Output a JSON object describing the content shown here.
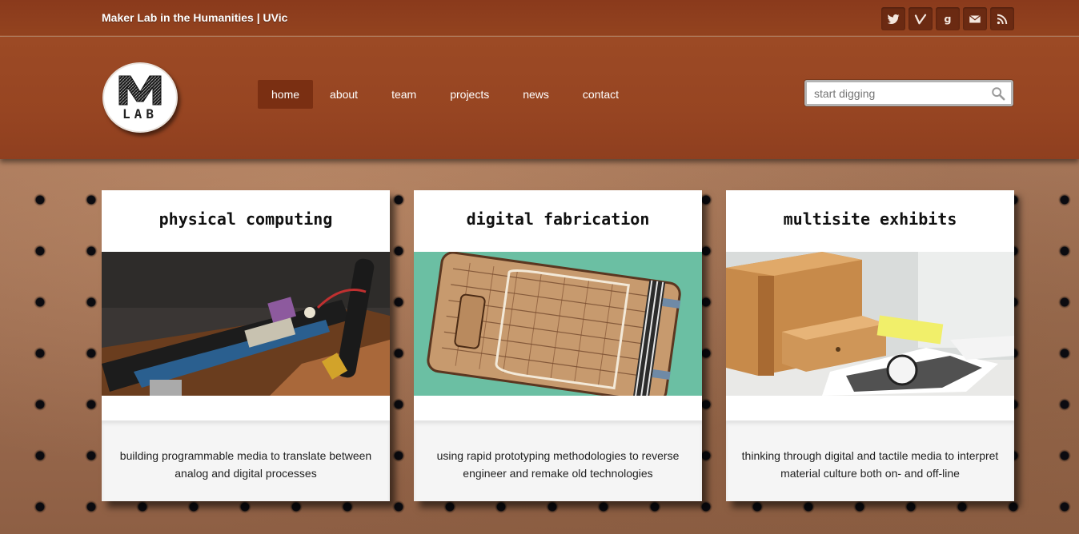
{
  "site": {
    "name": "Maker Lab in the Humanities | UVic"
  },
  "social": [
    {
      "icon": "twitter-icon",
      "label": "twitter"
    },
    {
      "icon": "vimeo-icon",
      "label": "v"
    },
    {
      "icon": "google-icon",
      "label": "g"
    },
    {
      "icon": "email-icon",
      "label": "email"
    },
    {
      "icon": "rss-icon",
      "label": "rss"
    }
  ],
  "logo": {
    "text": "LAB",
    "letter": "M"
  },
  "nav": {
    "items": [
      {
        "label": "home",
        "active": true
      },
      {
        "label": "about"
      },
      {
        "label": "team"
      },
      {
        "label": "projects"
      },
      {
        "label": "news"
      },
      {
        "label": "contact"
      }
    ]
  },
  "search": {
    "placeholder": "start digging"
  },
  "cards": [
    {
      "title": "physical computing",
      "description": "building programmable media to translate between analog and digital processes"
    },
    {
      "title": "digital fabrication",
      "description": "using rapid prototyping methodologies to reverse engineer and remake old technologies"
    },
    {
      "title": "multisite exhibits",
      "description": "thinking through digital and tactile media to interpret material culture both on- and off-line"
    }
  ],
  "colors": {
    "header": "#974522",
    "topbar": "#8a3a1c",
    "nav_active": "#7a2f12",
    "card_desc_bg": "#f5f5f5"
  }
}
